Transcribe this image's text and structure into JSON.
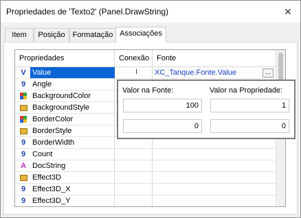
{
  "window": {
    "title": "Propriedades de 'Texto2' (Panel.DrawString)",
    "close_label": "✕"
  },
  "tabs": [
    {
      "label": "Item"
    },
    {
      "label": "Posição"
    },
    {
      "label": "Formatação"
    },
    {
      "label": "Associações"
    }
  ],
  "active_tab": "Associações",
  "grid": {
    "headers": {
      "properties": "Propriedades",
      "connection": "Conexão",
      "source": "Fonte"
    },
    "rows": [
      {
        "name": "Value",
        "icon": "value-icon",
        "selected": true,
        "source": "XC_Tanque.Fonte.Value"
      },
      {
        "name": "Angle",
        "icon": "number-icon"
      },
      {
        "name": "BackgroundColor",
        "icon": "color-icon"
      },
      {
        "name": "BackgroundStyle",
        "icon": "style-icon"
      },
      {
        "name": "BorderColor",
        "icon": "color-icon"
      },
      {
        "name": "BorderStyle",
        "icon": "style-icon"
      },
      {
        "name": "BorderWidth",
        "icon": "number-icon"
      },
      {
        "name": "Count",
        "icon": "number-icon"
      },
      {
        "name": "DocString",
        "icon": "text-icon"
      },
      {
        "name": "Effect3D",
        "icon": "style-icon"
      },
      {
        "name": "Effect3D_X",
        "icon": "number-icon"
      },
      {
        "name": "Effect3D_Y",
        "icon": "number-icon"
      }
    ],
    "ellipsis_label": "..."
  },
  "popup": {
    "source_label": "Valor na Fonte:",
    "property_label": "Valor na Propriedade:",
    "rows": [
      {
        "source_value": "100",
        "property_value": "1"
      },
      {
        "source_value": "0",
        "property_value": "0"
      }
    ]
  },
  "colors": {
    "selection": "#0a64d6",
    "link_text": "#1a3ec8",
    "number_icon": "#1f3fae",
    "text_icon": "#c030c0"
  }
}
